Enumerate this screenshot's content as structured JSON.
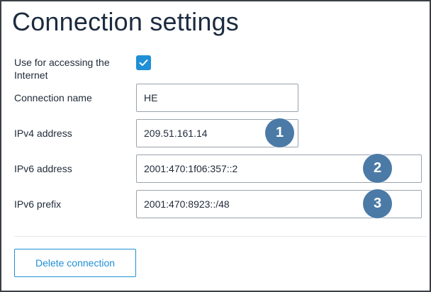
{
  "page": {
    "title": "Connection settings"
  },
  "form": {
    "internet_access": {
      "label": "Use for accessing the Internet",
      "checked": true
    },
    "connection_name": {
      "label": "Connection name",
      "value": "HE"
    },
    "ipv4_address": {
      "label": "IPv4 address",
      "value": "209.51.161.14"
    },
    "ipv6_address": {
      "label": "IPv6 address",
      "value": "2001:470:1f06:357::2"
    },
    "ipv6_prefix": {
      "label": "IPv6 prefix",
      "value": "2001:470:8923::/48"
    }
  },
  "markers": [
    "1",
    "2",
    "3"
  ],
  "actions": {
    "delete_label": "Delete connection"
  },
  "colors": {
    "accent": "#1f8fd6",
    "marker": "#4b7aa6",
    "title": "#1c2b3f"
  }
}
